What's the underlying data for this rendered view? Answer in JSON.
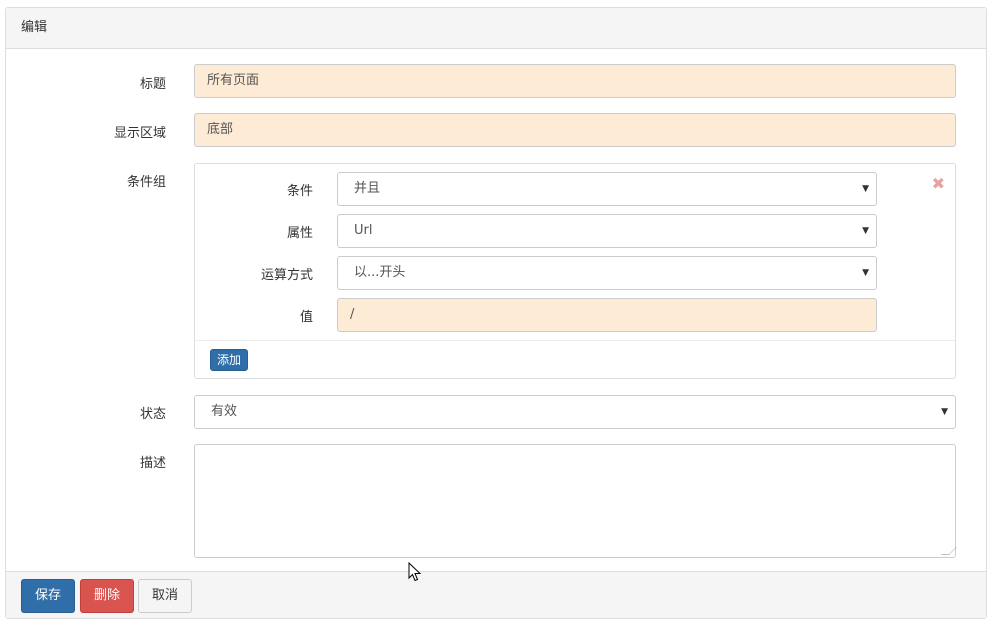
{
  "panel": {
    "title": "编辑"
  },
  "form": {
    "title_label": "标题",
    "title_value": "所有页面",
    "area_label": "显示区域",
    "area_value": "底部",
    "group_label": "条件组",
    "condition_group": {
      "condition_label": "条件",
      "condition_value": "并且",
      "attribute_label": "属性",
      "attribute_value": "Url",
      "operator_label": "运算方式",
      "operator_value": "以...开头",
      "value_label": "值",
      "value_value": "/",
      "add_label": "添加",
      "remove_icon": "✖"
    },
    "status_label": "状态",
    "status_value": "有效",
    "description_label": "描述",
    "description_value": ""
  },
  "footer": {
    "save_label": "保存",
    "delete_label": "删除",
    "cancel_label": "取消"
  },
  "icons": {
    "caret": "▼"
  }
}
